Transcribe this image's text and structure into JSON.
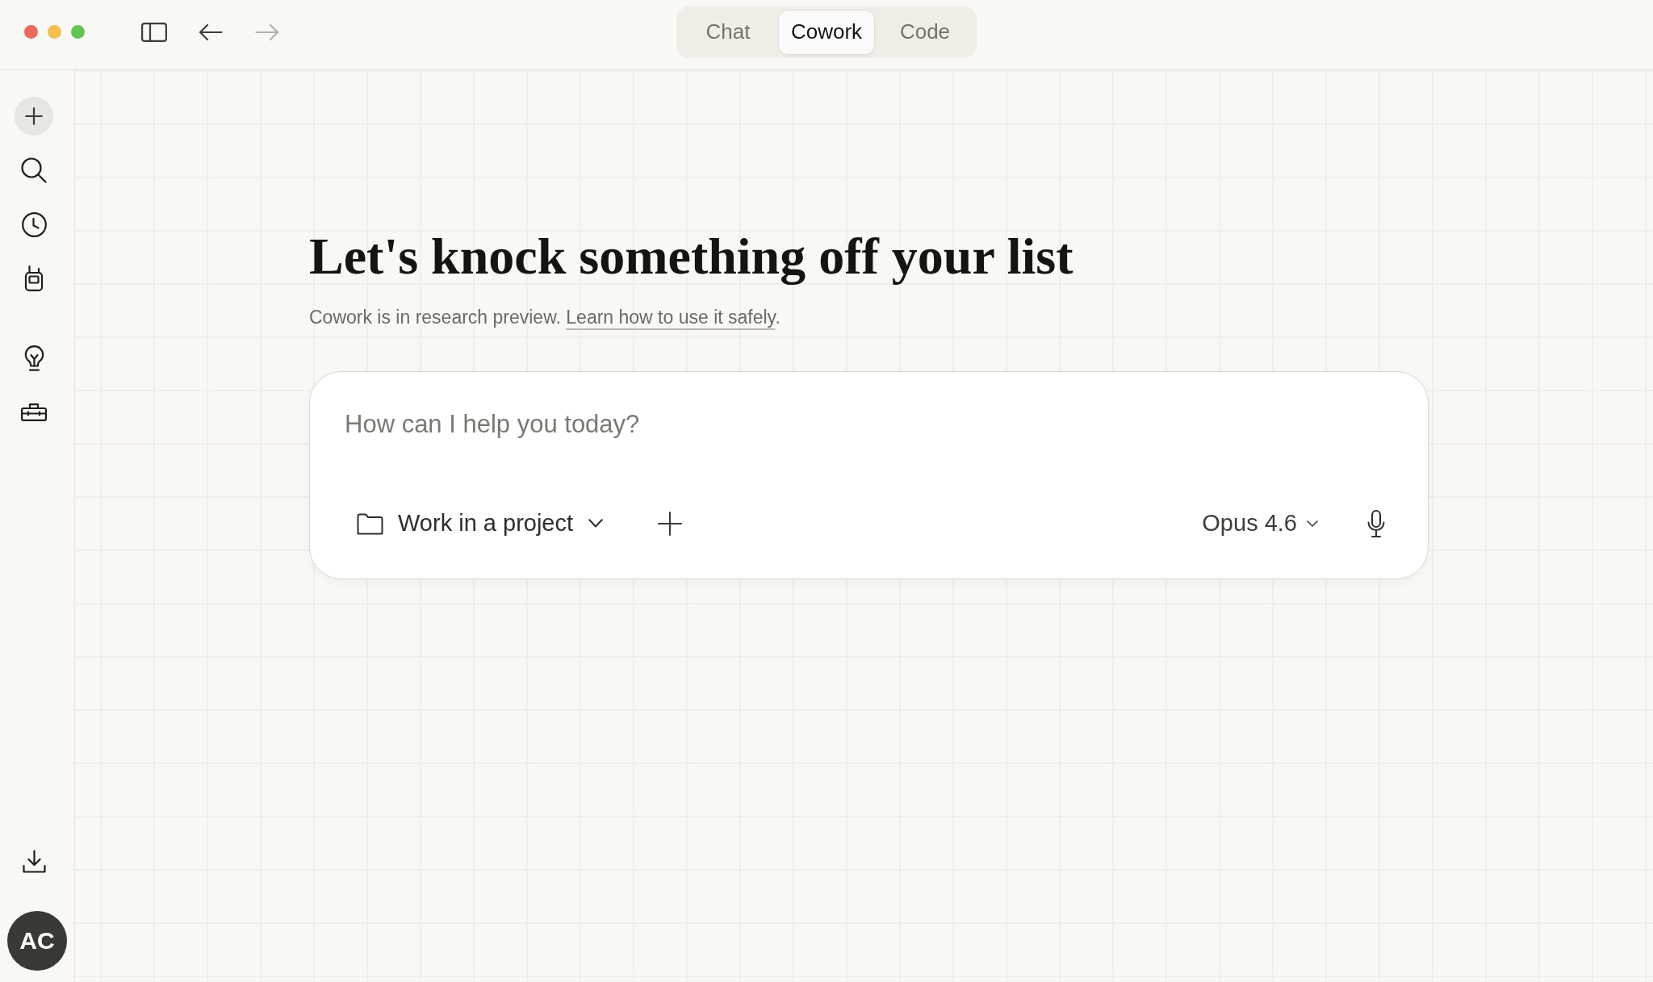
{
  "navigation": {
    "back": {
      "disabled": false
    },
    "forward": {
      "disabled": true
    }
  },
  "mode_tabs": [
    {
      "label": "Chat",
      "selected": false
    },
    {
      "label": "Cowork",
      "selected": true
    },
    {
      "label": "Code",
      "selected": false
    }
  ],
  "heading": "Let's knock something off your list",
  "notice": {
    "text": "Cowork is in research preview.",
    "link": "Learn how to use it safely",
    "after_link": "."
  },
  "composer": {
    "placeholder": "How can I help you today?",
    "project_selector": "Work in a project",
    "model_selector": "Opus 4.6"
  },
  "account": {
    "initials": "AC"
  }
}
